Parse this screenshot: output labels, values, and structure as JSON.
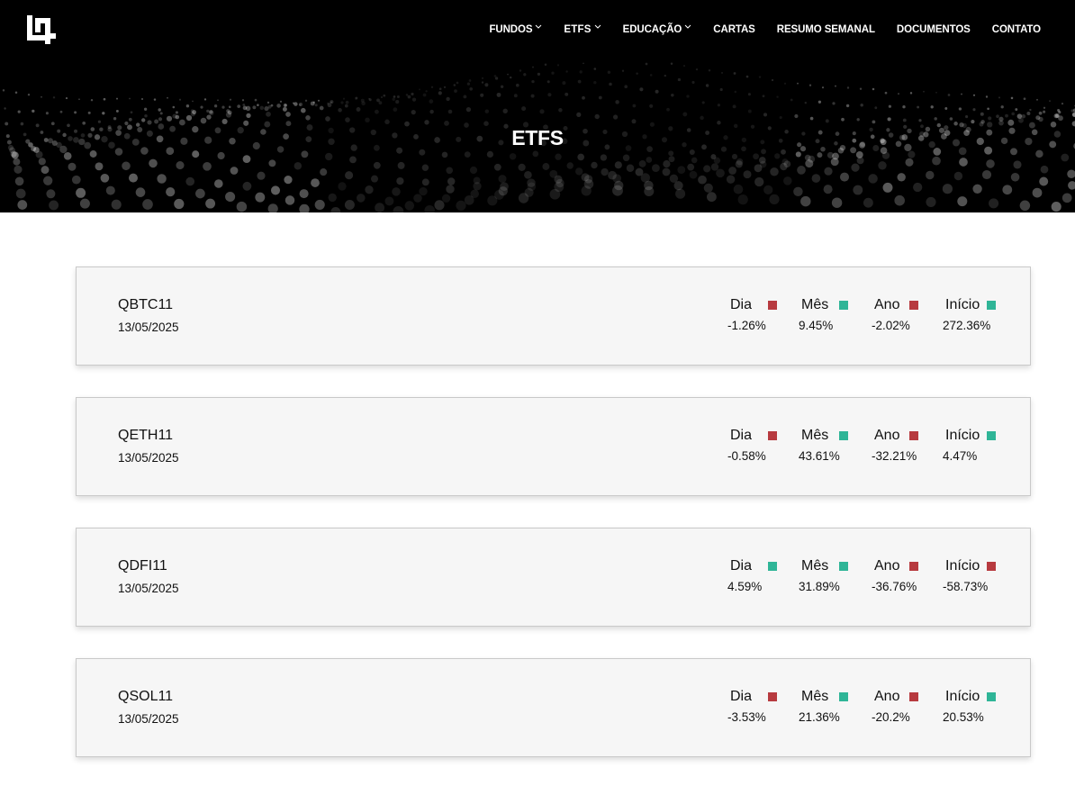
{
  "header": {
    "nav": [
      {
        "label": "FUNDOS",
        "dropdown": true,
        "active": false
      },
      {
        "label": "ETFS",
        "dropdown": true,
        "active": true
      },
      {
        "label": "EDUCAÇÃO",
        "dropdown": true,
        "active": false
      },
      {
        "label": "CARTAS",
        "dropdown": false,
        "active": false
      },
      {
        "label": "RESUMO SEMANAL",
        "dropdown": false,
        "active": false
      },
      {
        "label": "DOCUMENTOS",
        "dropdown": false,
        "active": false
      },
      {
        "label": "CONTATO",
        "dropdown": false,
        "active": false
      }
    ],
    "page_title": "ETFS"
  },
  "colors": {
    "negative": "#b73a3f",
    "positive": "#2fb597",
    "hero_bg": "#000000"
  },
  "labels": {
    "dia": "Dia",
    "mes": "Mês",
    "ano": "Ano",
    "inicio": "Início"
  },
  "etfs": [
    {
      "ticker": "QBTC11",
      "date": "13/05/2025",
      "dia": {
        "value": "-1.26%",
        "trend": "negative"
      },
      "mes": {
        "value": "9.45%",
        "trend": "positive"
      },
      "ano": {
        "value": "-2.02%",
        "trend": "negative"
      },
      "inicio": {
        "value": "272.36%",
        "trend": "positive"
      }
    },
    {
      "ticker": "QETH11",
      "date": "13/05/2025",
      "dia": {
        "value": "-0.58%",
        "trend": "negative"
      },
      "mes": {
        "value": "43.61%",
        "trend": "positive"
      },
      "ano": {
        "value": "-32.21%",
        "trend": "negative"
      },
      "inicio": {
        "value": "4.47%",
        "trend": "positive"
      }
    },
    {
      "ticker": "QDFI11",
      "date": "13/05/2025",
      "dia": {
        "value": "4.59%",
        "trend": "positive"
      },
      "mes": {
        "value": "31.89%",
        "trend": "positive"
      },
      "ano": {
        "value": "-36.76%",
        "trend": "negative"
      },
      "inicio": {
        "value": "-58.73%",
        "trend": "negative"
      }
    },
    {
      "ticker": "QSOL11",
      "date": "13/05/2025",
      "dia": {
        "value": "-3.53%",
        "trend": "negative"
      },
      "mes": {
        "value": "21.36%",
        "trend": "positive"
      },
      "ano": {
        "value": "-20.2%",
        "trend": "negative"
      },
      "inicio": {
        "value": "20.53%",
        "trend": "positive"
      }
    }
  ]
}
